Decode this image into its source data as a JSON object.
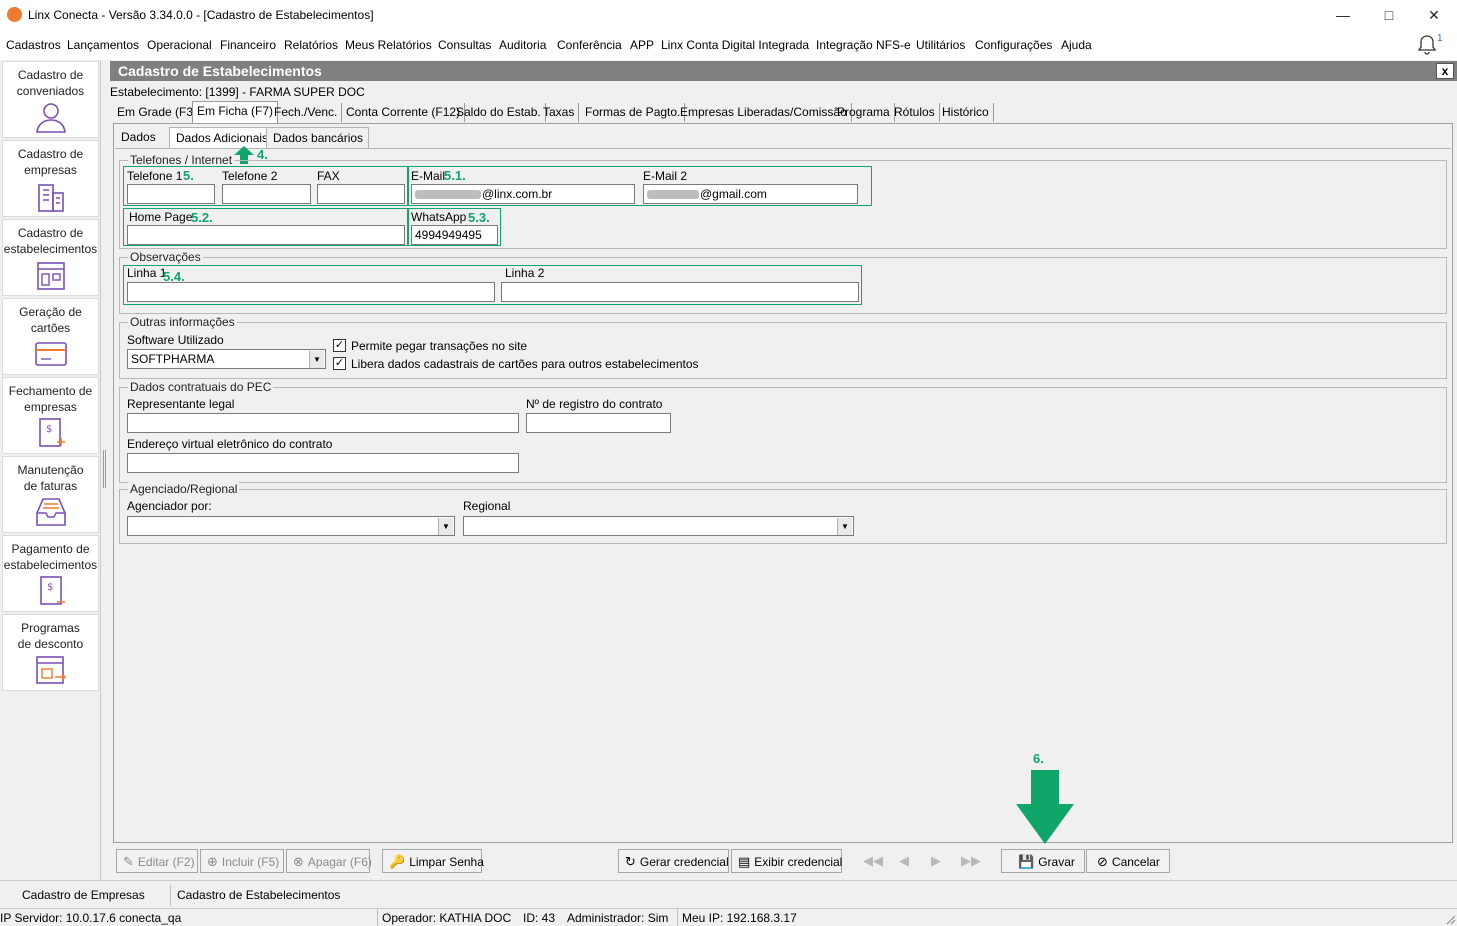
{
  "window": {
    "title": "Linx Conecta - Versão 3.34.0.0 - [Cadastro de Estabelecimentos]"
  },
  "menu": [
    "Cadastros",
    "Lançamentos",
    "Operacional",
    "Financeiro",
    "Relatórios",
    "Meus Relatórios",
    "Consultas",
    "Auditoria",
    "Conferência",
    "APP",
    "Linx Conta Digital Integrada",
    "Integração NFS-e",
    "Utilitários",
    "Configurações",
    "Ajuda"
  ],
  "notifications": {
    "count": "1"
  },
  "sidebar": [
    {
      "l1": "Cadastro de",
      "l2": "conveniados",
      "icon": "user-icon"
    },
    {
      "l1": "Cadastro de",
      "l2": "empresas",
      "icon": "building-icon"
    },
    {
      "l1": "Cadastro de",
      "l2": "estabelecimentos",
      "icon": "store-icon"
    },
    {
      "l1": "Geração de",
      "l2": "cartões",
      "icon": "card-icon"
    },
    {
      "l1": "Fechamento de",
      "l2": "empresas",
      "icon": "invoice-close-icon"
    },
    {
      "l1": "Manutenção",
      "l2": "de faturas",
      "icon": "inbox-icon"
    },
    {
      "l1": "Pagamento de",
      "l2": "estabelecimentos",
      "icon": "payment-icon"
    },
    {
      "l1": "Programas",
      "l2": "de desconto",
      "icon": "discount-icon"
    }
  ],
  "header": {
    "title": "Cadastro de Estabelecimentos",
    "close": "x",
    "estab": "Estabelecimento: [1399] - FARMA SUPER DOC"
  },
  "tabs": [
    "Em Grade (F3)",
    "Em Ficha (F7)",
    "Fech./Venc.",
    "Conta Corrente (F12)",
    "Saldo do Estab.",
    "Taxas",
    "Formas de Pagto.",
    "Empresas Liberadas/Comissão",
    "Programa",
    "Rótulos",
    "Histórico"
  ],
  "subtabs": [
    "Dados",
    "Dados Adicionais",
    "Dados bancários"
  ],
  "telefones": {
    "title": "Telefones / Internet",
    "telefone1_label": "Telefone 1",
    "telefone2_label": "Telefone 2",
    "fax_label": "FAX",
    "email_label": "E-Mail",
    "email_value": "@linx.com.br",
    "email2_label": "E-Mail 2",
    "email2_value": "@gmail.com",
    "homepage_label": "Home Page",
    "whatsapp_label": "WhatsApp",
    "whatsapp_value": "4994949495"
  },
  "observacoes": {
    "title": "Observações",
    "linha1_label": "Linha 1",
    "linha2_label": "Linha 2"
  },
  "outras": {
    "title": "Outras informações",
    "software_label": "Software Utilizado",
    "software_value": "SOFTPHARMA",
    "chk1": "Permite pegar transações no site",
    "chk2": "Libera dados cadastrais de cartões para outros estabelecimentos"
  },
  "contratuais": {
    "title": "Dados contratuais do PEC",
    "rep_label": "Representante legal",
    "registro_label": "Nº de registro do contrato",
    "endereco_label": "Endereço virtual eletrônico do contrato"
  },
  "agenciado": {
    "title": "Agenciado/Regional",
    "agenciador_label": "Agenciador por:",
    "regional_label": "Regional"
  },
  "annotations": {
    "a4": "4.",
    "a5": "5.",
    "a51": "5.1.",
    "a52": "5.2.",
    "a53": "5.3.",
    "a54": "5.4.",
    "a6": "6."
  },
  "buttons": {
    "editar": "Editar (F2)",
    "incluir": "Incluir (F5)",
    "apagar": "Apagar (F6)",
    "limpar": "Limpar Senha",
    "gerar": "Gerar credencial",
    "exibir": "Exibir credencial",
    "gravar": "Gravar",
    "cancelar": "Cancelar"
  },
  "statusbar": {
    "tab1": "Cadastro de Empresas",
    "tab2": "Cadastro de Estabelecimentos"
  },
  "info": {
    "ip": "IP Servidor: 10.0.17.6 conecta_qa",
    "operador": "Operador: KATHIA DOC",
    "id": "ID: 43",
    "admin": "Administrador: Sim",
    "meuip": "Meu IP: 192.168.3.17"
  },
  "colors": {
    "accent": "#10a66a",
    "header": "#808080",
    "logo": "#f07a2e"
  }
}
